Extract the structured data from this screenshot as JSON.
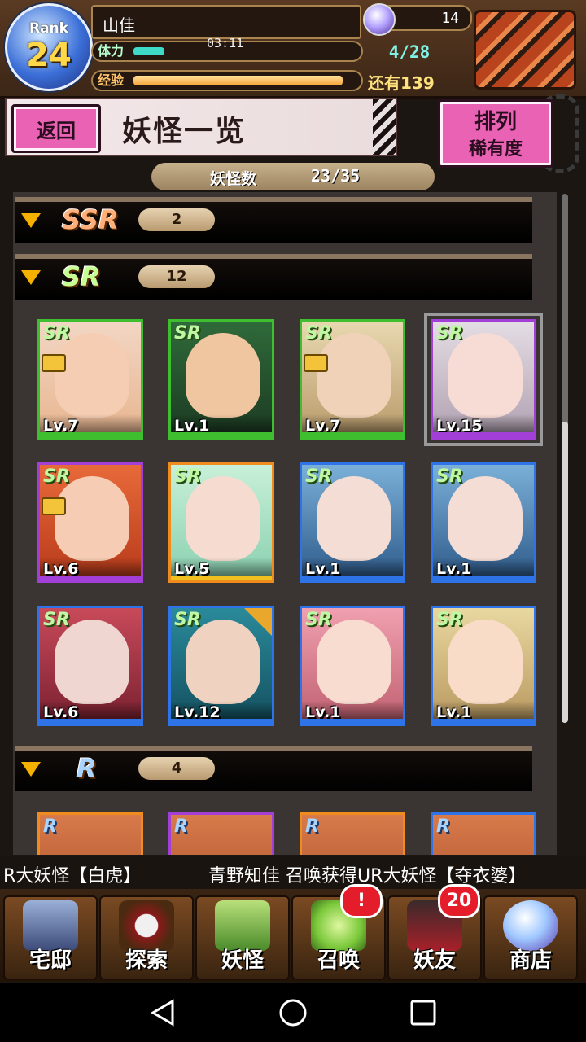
{
  "status": {
    "rank_label": "Rank",
    "rank_value": "24",
    "player_name": "山佳",
    "stamina_label": "体力",
    "stamina_timer": "03:11",
    "stamina_value": "4/28",
    "stamina_fraction": 0.14,
    "exp_label": "经验",
    "exp_remaining": "还有139",
    "exp_fraction": 0.95,
    "gems": "14"
  },
  "header": {
    "back_label": "返回",
    "title": "妖怪一览",
    "sort_label": "排列",
    "sort_value": "稀有度"
  },
  "count": {
    "label": "妖怪数",
    "value": "23/35"
  },
  "sections": [
    {
      "rarity": "SSR",
      "count": "2"
    },
    {
      "rarity": "SR",
      "count": "12"
    },
    {
      "rarity": "R",
      "count": "4"
    }
  ],
  "sr_cards": [
    {
      "rarity": "SR",
      "level": "Lv.7"
    },
    {
      "rarity": "SR",
      "level": "Lv.1"
    },
    {
      "rarity": "SR",
      "level": "Lv.7"
    },
    {
      "rarity": "SR",
      "level": "Lv.15"
    },
    {
      "rarity": "SR",
      "level": "Lv.6"
    },
    {
      "rarity": "SR",
      "level": "Lv.5"
    },
    {
      "rarity": "SR",
      "level": "Lv.1"
    },
    {
      "rarity": "SR",
      "level": "Lv.1"
    },
    {
      "rarity": "SR",
      "level": "Lv.6"
    },
    {
      "rarity": "SR",
      "level": "Lv.12"
    },
    {
      "rarity": "SR",
      "level": "Lv.1"
    },
    {
      "rarity": "SR",
      "level": "Lv.1"
    }
  ],
  "r_cards": [
    {
      "rarity": "R"
    },
    {
      "rarity": "R"
    },
    {
      "rarity": "R"
    },
    {
      "rarity": "R"
    }
  ],
  "ticker": {
    "left": "R大妖怪【白虎】",
    "right": "青野知佳 召唤获得UR大妖怪【夺衣婆】"
  },
  "nav": {
    "items": [
      {
        "label": "宅邸"
      },
      {
        "label": "探索"
      },
      {
        "label": "妖怪"
      },
      {
        "label": "召唤",
        "badge": "!"
      },
      {
        "label": "妖友",
        "badge": "20"
      },
      {
        "label": "商店"
      }
    ]
  },
  "icons": {
    "gem": "gem-icon",
    "chest": "treasure-chest-icon",
    "gear": "gear-icon",
    "lock": "lock-icon",
    "favorite": "star-icon",
    "collapse": "triangle-down-icon"
  },
  "colors": {
    "accent_pink": "#ea62b4",
    "sr_frame_green": "#3fbf2f",
    "sr_frame_purple": "#a13fd6",
    "sr_frame_blue": "#2f73e8",
    "badge_red": "#e51d2a"
  }
}
